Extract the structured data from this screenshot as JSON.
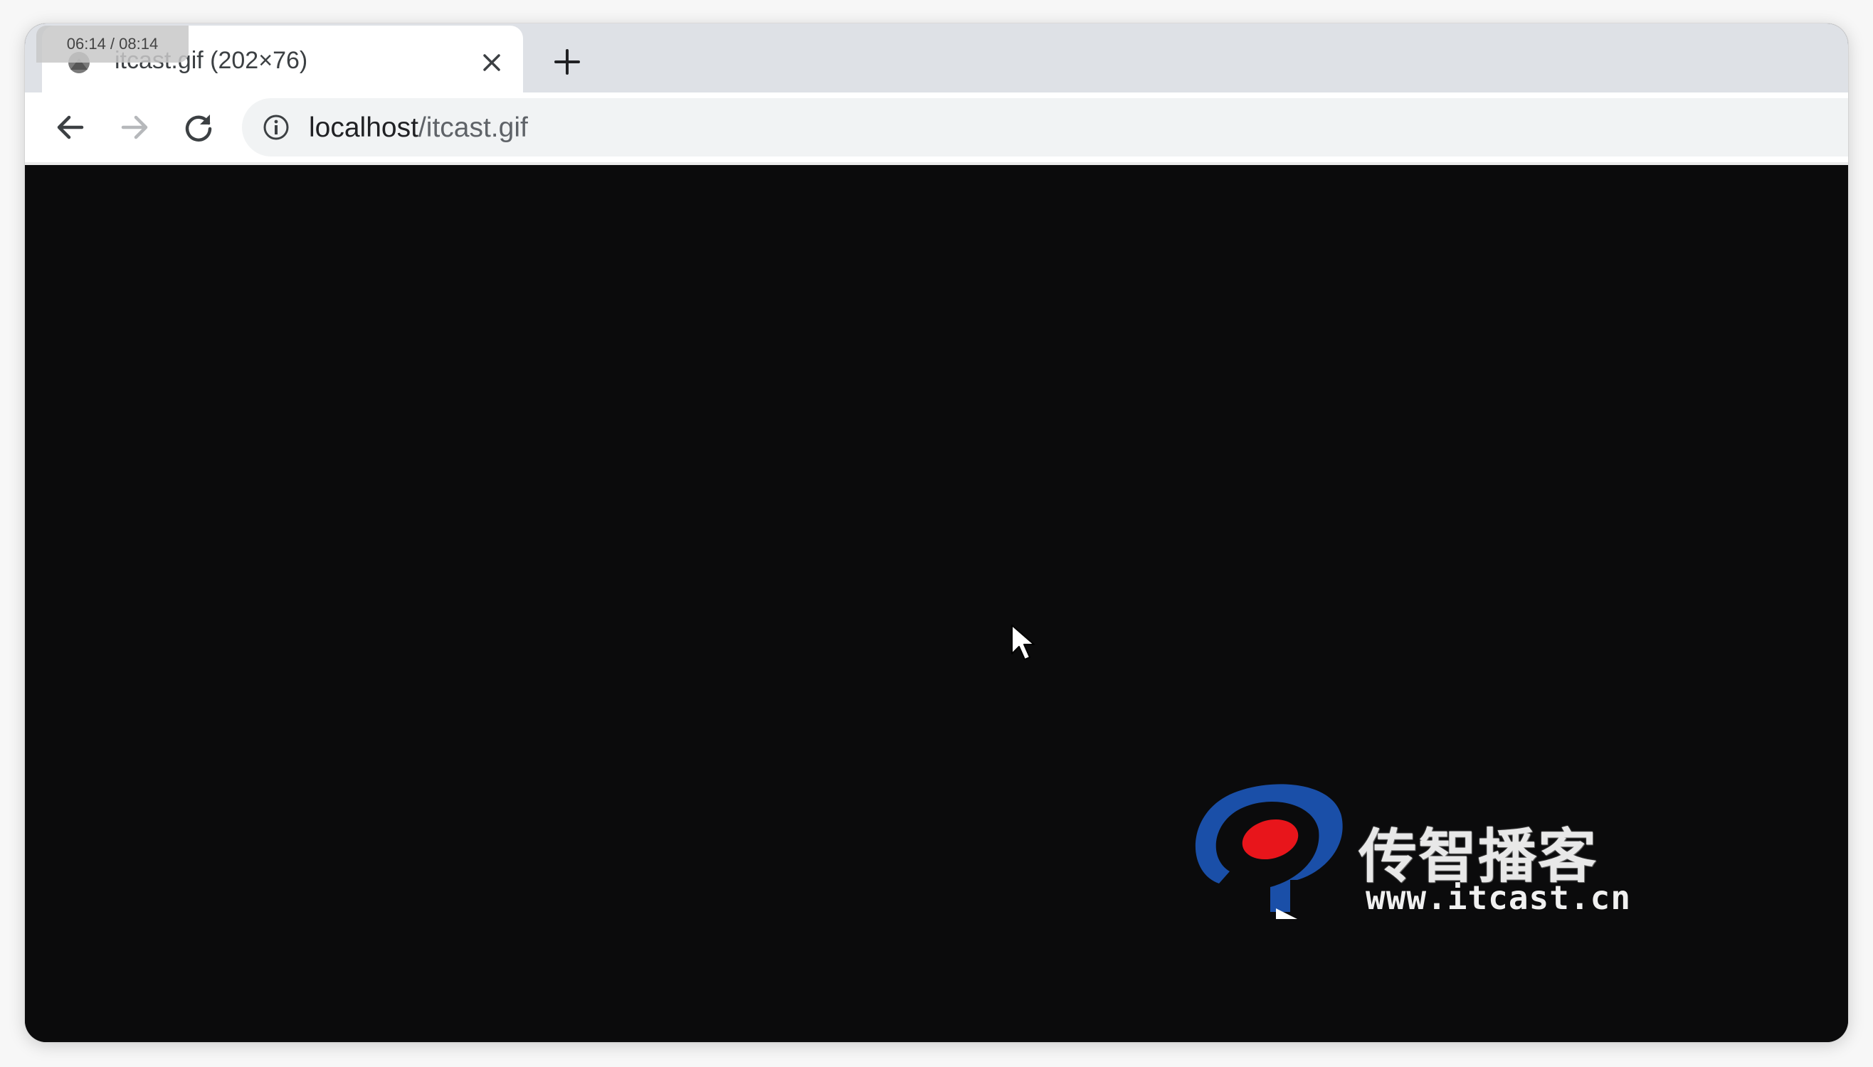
{
  "overlay": {
    "timestamp": "06:14 / 08:14"
  },
  "tab": {
    "title": "itcast.gif (202×76)",
    "favicon": "image-file-icon",
    "close_icon": "close-icon"
  },
  "new_tab_icon": "plus-icon",
  "toolbar": {
    "back_icon": "arrow-left-icon",
    "forward_icon": "arrow-right-icon",
    "reload_icon": "reload-icon",
    "info_icon": "info-icon"
  },
  "address_bar": {
    "host": "localhost",
    "path": "/itcast.gif"
  },
  "content": {
    "background": "#0b0b0c",
    "logo": {
      "chinese_text": "传智播客",
      "url_text": "www.itcast.cn",
      "colors": {
        "blue": "#1a4fa8",
        "red": "#e8151b"
      }
    }
  }
}
